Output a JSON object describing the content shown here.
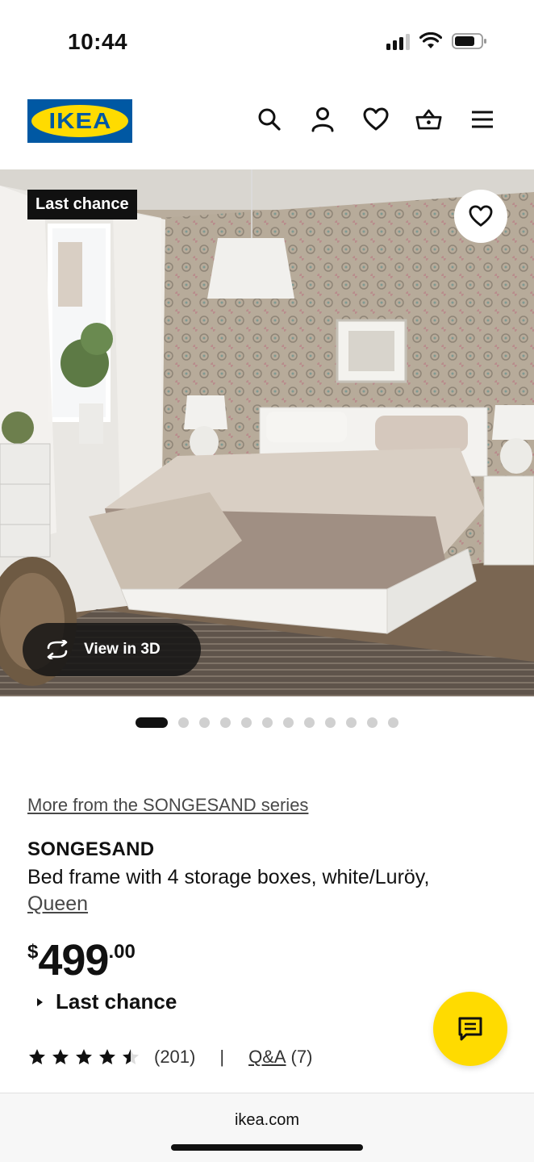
{
  "status_bar": {
    "time": "10:44"
  },
  "header": {
    "logo_text": "IKEA",
    "icons": [
      "search-icon",
      "account-icon",
      "heart-icon",
      "basket-icon",
      "menu-icon"
    ]
  },
  "hero": {
    "badge": "Last chance",
    "view_3d_label": "View in 3D"
  },
  "carousel": {
    "total": 12,
    "active_index": 0
  },
  "product": {
    "series_link": "More from the SONGESAND series",
    "name": "SONGESAND",
    "description": "Bed frame with 4 storage boxes, white/Luröy,",
    "size": "Queen",
    "price_currency": "$",
    "price_integer": "499",
    "price_decimal": ".00",
    "availability": "Last chance",
    "rating_value": 4.5,
    "rating_max": 5,
    "review_count": "(201)",
    "separator": "|",
    "qa_label": "Q&A",
    "qa_count": "(7)"
  },
  "browser": {
    "url": "ikea.com"
  },
  "colors": {
    "brand_blue": "#0058a3",
    "brand_yellow": "#ffdb00",
    "text": "#111111"
  }
}
